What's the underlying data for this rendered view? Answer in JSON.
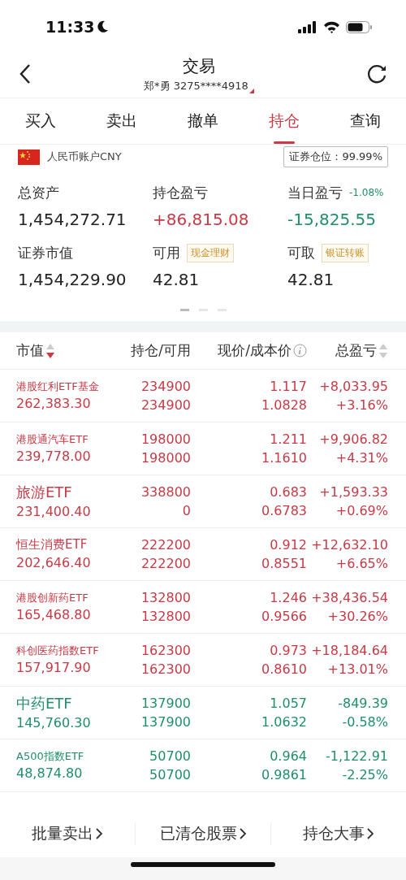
{
  "status_bar": {
    "time": "11:33"
  },
  "header": {
    "title": "交易",
    "account": "郑*勇 3275****4918"
  },
  "tabs": [
    {
      "label": "买入",
      "selected": false
    },
    {
      "label": "卖出",
      "selected": false
    },
    {
      "label": "撤单",
      "selected": false
    },
    {
      "label": "持仓",
      "selected": true
    },
    {
      "label": "查询",
      "selected": false
    }
  ],
  "account": {
    "label": "人民币账户CNY",
    "position": "证券仓位：99.99%"
  },
  "summary": [
    {
      "label": "总资产",
      "value": "1,454,272.71",
      "color": "#222222"
    },
    {
      "label": "持仓盈亏",
      "value": "+86,815.08",
      "color": "#c83a45"
    },
    {
      "label": "当日盈亏",
      "note": "-1.08%",
      "value": "-15,825.55",
      "color": "#1f8f6a"
    },
    {
      "label": "证券市值",
      "value": "1,454,229.90",
      "color": "#222222"
    },
    {
      "label": "可用",
      "tag": "现金理财",
      "value": "42.81",
      "color": "#222222"
    },
    {
      "label": "可取",
      "tag": "银证转账",
      "value": "42.81",
      "color": "#222222"
    }
  ],
  "pager": [
    {
      "selected": true
    },
    {
      "selected": false
    },
    {
      "selected": false
    }
  ],
  "table": {
    "columns": [
      {
        "label": "市值",
        "sortable": true,
        "sorted": true
      },
      {
        "label": "持仓/可用"
      },
      {
        "label": "现价/成本价",
        "info": true
      },
      {
        "label": "总盈亏",
        "sortable": true,
        "sorted": false
      }
    ],
    "rows": [
      {
        "name": "港股红利ETF基金",
        "market_value": "262,383.30",
        "holding": "234900",
        "available": "234900",
        "price": "1.117",
        "cost": "1.0828",
        "pnl": "+8,033.95",
        "pnl_pct": "+3.16%",
        "color": "#c83a45"
      },
      {
        "name": "港股通汽车ETF",
        "market_value": "239,778.00",
        "holding": "198000",
        "available": "198000",
        "price": "1.211",
        "cost": "1.1610",
        "pnl": "+9,906.82",
        "pnl_pct": "+4.31%",
        "color": "#c83a45"
      },
      {
        "name": "旅游ETF",
        "market_value": "231,400.40",
        "holding": "338800",
        "available": "0",
        "price": "0.683",
        "cost": "0.6783",
        "pnl": "+1,593.33",
        "pnl_pct": "+0.69%",
        "color": "#c83a45"
      },
      {
        "name": "恒生消费ETF",
        "market_value": "202,646.40",
        "holding": "222200",
        "available": "222200",
        "price": "0.912",
        "cost": "0.8551",
        "pnl": "+12,632.10",
        "pnl_pct": "+6.65%",
        "color": "#c83a45"
      },
      {
        "name": "港股创新药ETF",
        "market_value": "165,468.80",
        "holding": "132800",
        "available": "132800",
        "price": "1.246",
        "cost": "0.9566",
        "pnl": "+38,436.54",
        "pnl_pct": "+30.26%",
        "color": "#c83a45"
      },
      {
        "name": "科创医药指数ETF",
        "market_value": "157,917.90",
        "holding": "162300",
        "available": "162300",
        "price": "0.973",
        "cost": "0.8610",
        "pnl": "+18,184.64",
        "pnl_pct": "+13.01%",
        "color": "#c83a45"
      },
      {
        "name": "中药ETF",
        "market_value": "145,760.30",
        "holding": "137900",
        "available": "137900",
        "price": "1.057",
        "cost": "1.0632",
        "pnl": "-849.39",
        "pnl_pct": "-0.58%",
        "color": "#1f8f6a"
      },
      {
        "name": "A500指数ETF",
        "market_value": "48,874.80",
        "holding": "50700",
        "available": "50700",
        "price": "0.964",
        "cost": "0.9861",
        "pnl": "-1,122.91",
        "pnl_pct": "-2.25%",
        "color": "#1f8f6a"
      }
    ]
  },
  "footer": [
    {
      "label": "批量卖出"
    },
    {
      "label": "已清仓股票"
    },
    {
      "label": "持仓大事"
    }
  ]
}
